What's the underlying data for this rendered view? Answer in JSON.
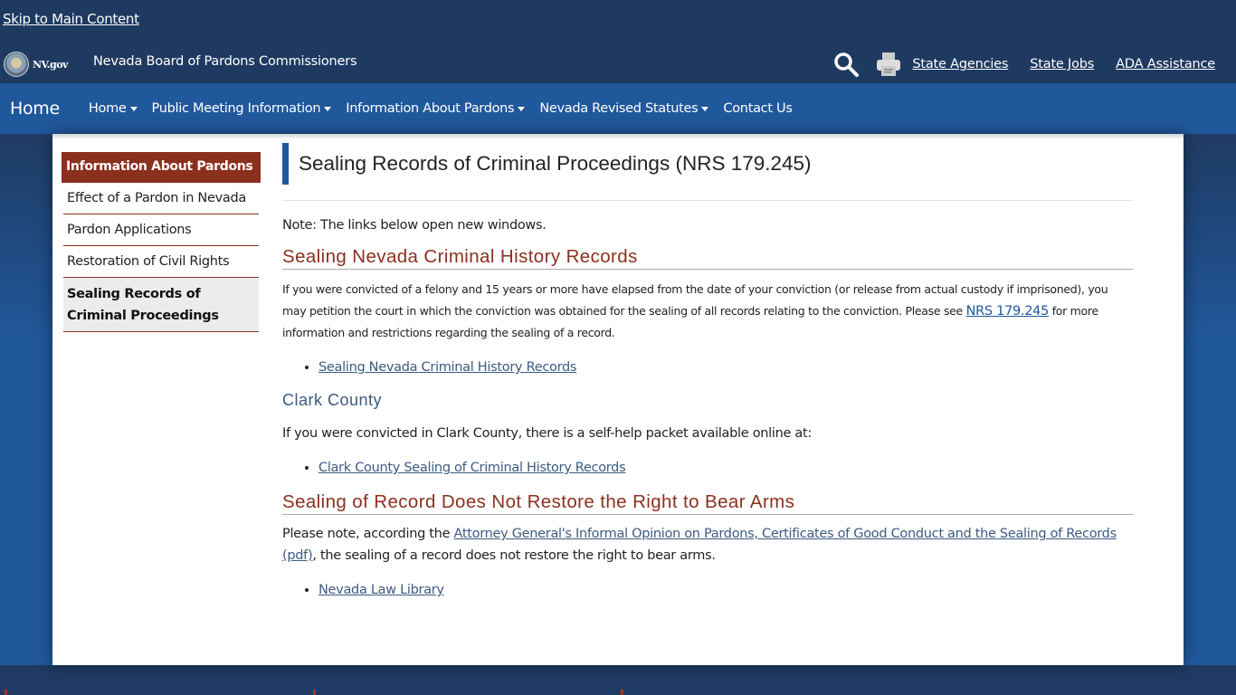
{
  "header": {
    "skip_link": "Skip to Main Content",
    "nvgov_label": "NV.gov",
    "agency_name": "Nevada Board of Pardons Commissioners",
    "utility_icons": [
      "search-icon",
      "print-icon"
    ],
    "utility_links": [
      "State Agencies",
      "State Jobs",
      "ADA Assistance"
    ]
  },
  "nav": {
    "brand": "Home",
    "items": [
      {
        "label": "Home",
        "dropdown": true
      },
      {
        "label": "Public Meeting Information",
        "dropdown": true
      },
      {
        "label": "Information About Pardons",
        "dropdown": true
      },
      {
        "label": "Nevada Revised Statutes",
        "dropdown": true
      },
      {
        "label": "Contact Us",
        "dropdown": false
      }
    ]
  },
  "sidebar": {
    "header": "Information About Pardons",
    "items": [
      {
        "label": "Effect of a Pardon in Nevada",
        "active": false
      },
      {
        "label": "Pardon Applications",
        "active": false
      },
      {
        "label": "Restoration of Civil Rights",
        "active": false
      },
      {
        "label": "Sealing Records of Criminal Proceedings",
        "active": true
      }
    ]
  },
  "main": {
    "title": "Sealing Records of Criminal Proceedings (NRS 179.245)",
    "note": "Note: The links below open new windows.",
    "section1": {
      "heading": "Sealing Nevada Criminal History Records",
      "text_before": "If you were convicted of a felony and 15 years or more have elapsed from the date of your conviction (or release from actual custody if imprisoned), you may petition the court in which the conviction was obtained for the sealing of all records relating to the conviction. Please see ",
      "link": "NRS 179.245",
      "text_after": " for more information and restrictions regarding the sealing of a record.",
      "list": [
        "Sealing Nevada Criminal History Records"
      ]
    },
    "section2": {
      "heading": "Clark County",
      "text": "If you were convicted in Clark County, there is a self-help packet available online at:",
      "list": [
        "Clark County Sealing of Criminal History Records"
      ]
    },
    "section3": {
      "heading": "Sealing of Record Does Not Restore the Right to Bear Arms",
      "text_before": "Please note, according the ",
      "link": "Attorney General's Informal Opinion on Pardons, Certificates of Good Conduct and the Sealing of Records (pdf)",
      "text_after": ", the sealing of a record does not restore the right to bear arms.",
      "list": [
        "Nevada Law Library"
      ]
    }
  },
  "colors": {
    "header_bg": "#1e3a60",
    "nav_bg": "#20589c",
    "accent_red": "#8c301e",
    "link_blue": "#3d5a80"
  }
}
